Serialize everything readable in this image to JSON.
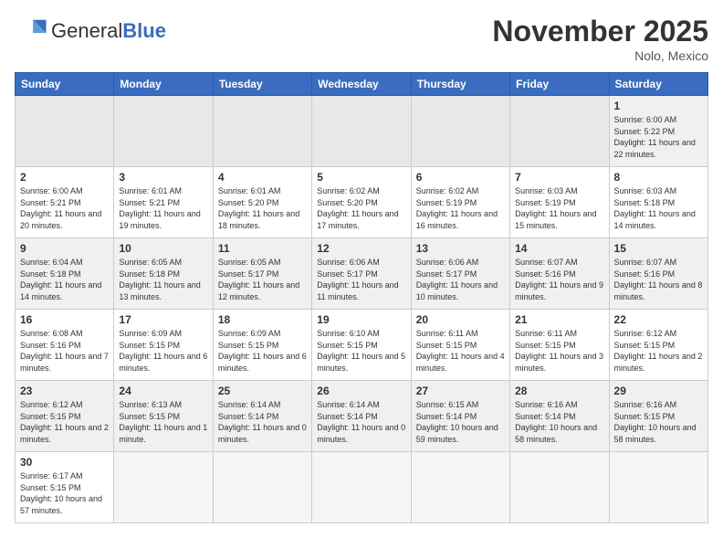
{
  "header": {
    "logo_general": "General",
    "logo_blue": "Blue",
    "month_title": "November 2025",
    "location": "Nolo, Mexico"
  },
  "days_of_week": [
    "Sunday",
    "Monday",
    "Tuesday",
    "Wednesday",
    "Thursday",
    "Friday",
    "Saturday"
  ],
  "weeks": [
    [
      {
        "day": "",
        "empty": true
      },
      {
        "day": "",
        "empty": true
      },
      {
        "day": "",
        "empty": true
      },
      {
        "day": "",
        "empty": true
      },
      {
        "day": "",
        "empty": true
      },
      {
        "day": "",
        "empty": true
      },
      {
        "day": "1",
        "sunrise": "6:00 AM",
        "sunset": "5:22 PM",
        "daylight": "11 hours and 22 minutes."
      }
    ],
    [
      {
        "day": "2",
        "sunrise": "6:00 AM",
        "sunset": "5:21 PM",
        "daylight": "11 hours and 20 minutes."
      },
      {
        "day": "3",
        "sunrise": "6:01 AM",
        "sunset": "5:21 PM",
        "daylight": "11 hours and 19 minutes."
      },
      {
        "day": "4",
        "sunrise": "6:01 AM",
        "sunset": "5:20 PM",
        "daylight": "11 hours and 18 minutes."
      },
      {
        "day": "5",
        "sunrise": "6:02 AM",
        "sunset": "5:20 PM",
        "daylight": "11 hours and 17 minutes."
      },
      {
        "day": "6",
        "sunrise": "6:02 AM",
        "sunset": "5:19 PM",
        "daylight": "11 hours and 16 minutes."
      },
      {
        "day": "7",
        "sunrise": "6:03 AM",
        "sunset": "5:19 PM",
        "daylight": "11 hours and 15 minutes."
      },
      {
        "day": "8",
        "sunrise": "6:03 AM",
        "sunset": "5:18 PM",
        "daylight": "11 hours and 14 minutes."
      }
    ],
    [
      {
        "day": "9",
        "sunrise": "6:04 AM",
        "sunset": "5:18 PM",
        "daylight": "11 hours and 14 minutes."
      },
      {
        "day": "10",
        "sunrise": "6:05 AM",
        "sunset": "5:18 PM",
        "daylight": "11 hours and 13 minutes."
      },
      {
        "day": "11",
        "sunrise": "6:05 AM",
        "sunset": "5:17 PM",
        "daylight": "11 hours and 12 minutes."
      },
      {
        "day": "12",
        "sunrise": "6:06 AM",
        "sunset": "5:17 PM",
        "daylight": "11 hours and 11 minutes."
      },
      {
        "day": "13",
        "sunrise": "6:06 AM",
        "sunset": "5:17 PM",
        "daylight": "11 hours and 10 minutes."
      },
      {
        "day": "14",
        "sunrise": "6:07 AM",
        "sunset": "5:16 PM",
        "daylight": "11 hours and 9 minutes."
      },
      {
        "day": "15",
        "sunrise": "6:07 AM",
        "sunset": "5:16 PM",
        "daylight": "11 hours and 8 minutes."
      }
    ],
    [
      {
        "day": "16",
        "sunrise": "6:08 AM",
        "sunset": "5:16 PM",
        "daylight": "11 hours and 7 minutes."
      },
      {
        "day": "17",
        "sunrise": "6:09 AM",
        "sunset": "5:15 PM",
        "daylight": "11 hours and 6 minutes."
      },
      {
        "day": "18",
        "sunrise": "6:09 AM",
        "sunset": "5:15 PM",
        "daylight": "11 hours and 6 minutes."
      },
      {
        "day": "19",
        "sunrise": "6:10 AM",
        "sunset": "5:15 PM",
        "daylight": "11 hours and 5 minutes."
      },
      {
        "day": "20",
        "sunrise": "6:11 AM",
        "sunset": "5:15 PM",
        "daylight": "11 hours and 4 minutes."
      },
      {
        "day": "21",
        "sunrise": "6:11 AM",
        "sunset": "5:15 PM",
        "daylight": "11 hours and 3 minutes."
      },
      {
        "day": "22",
        "sunrise": "6:12 AM",
        "sunset": "5:15 PM",
        "daylight": "11 hours and 2 minutes."
      }
    ],
    [
      {
        "day": "23",
        "sunrise": "6:12 AM",
        "sunset": "5:15 PM",
        "daylight": "11 hours and 2 minutes."
      },
      {
        "day": "24",
        "sunrise": "6:13 AM",
        "sunset": "5:15 PM",
        "daylight": "11 hours and 1 minute."
      },
      {
        "day": "25",
        "sunrise": "6:14 AM",
        "sunset": "5:14 PM",
        "daylight": "11 hours and 0 minutes."
      },
      {
        "day": "26",
        "sunrise": "6:14 AM",
        "sunset": "5:14 PM",
        "daylight": "11 hours and 0 minutes."
      },
      {
        "day": "27",
        "sunrise": "6:15 AM",
        "sunset": "5:14 PM",
        "daylight": "10 hours and 59 minutes."
      },
      {
        "day": "28",
        "sunrise": "6:16 AM",
        "sunset": "5:14 PM",
        "daylight": "10 hours and 58 minutes."
      },
      {
        "day": "29",
        "sunrise": "6:16 AM",
        "sunset": "5:15 PM",
        "daylight": "10 hours and 58 minutes."
      }
    ],
    [
      {
        "day": "30",
        "sunrise": "6:17 AM",
        "sunset": "5:15 PM",
        "daylight": "10 hours and 57 minutes."
      },
      {
        "day": "",
        "empty": true
      },
      {
        "day": "",
        "empty": true
      },
      {
        "day": "",
        "empty": true
      },
      {
        "day": "",
        "empty": true
      },
      {
        "day": "",
        "empty": true
      },
      {
        "day": "",
        "empty": true
      }
    ]
  ],
  "labels": {
    "sunrise": "Sunrise:",
    "sunset": "Sunset:",
    "daylight": "Daylight:"
  }
}
